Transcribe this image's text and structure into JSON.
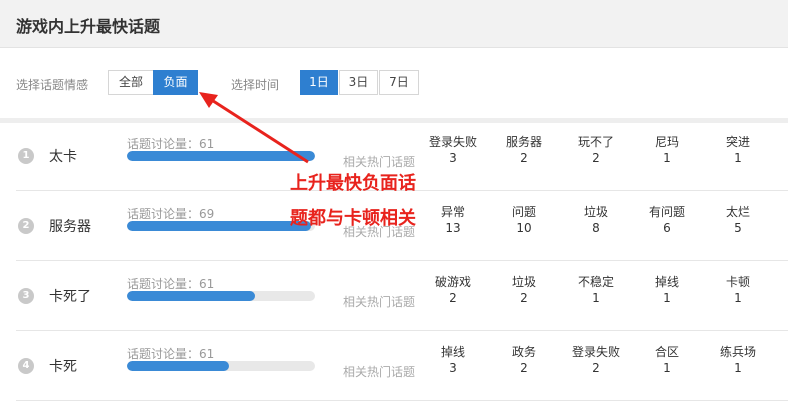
{
  "header": {
    "title": "游戏内上升最快话题"
  },
  "filters": {
    "emotion_label": "选择话题情感",
    "emotion_options": [
      "全部",
      "负面"
    ],
    "time_label": "选择时间",
    "time_options": [
      "1日",
      "3日",
      "7日"
    ]
  },
  "rows": [
    {
      "rank": "1",
      "topic": "太卡",
      "volume_label": "话题讨论量：61",
      "volume_fraction": 1.0,
      "related_label": "相关热门话题",
      "keywords": [
        {
          "w": "登录失败",
          "n": "3"
        },
        {
          "w": "服务器",
          "n": "2"
        },
        {
          "w": "玩不了",
          "n": "2"
        },
        {
          "w": "尼玛",
          "n": "1"
        },
        {
          "w": "突进",
          "n": "1"
        }
      ]
    },
    {
      "rank": "2",
      "topic": "服务器",
      "volume_label": "话题讨论量：69",
      "volume_fraction": 0.98,
      "related_label": "相关热门话题",
      "keywords": [
        {
          "w": "异常",
          "n": "13"
        },
        {
          "w": "问题",
          "n": "10"
        },
        {
          "w": "垃圾",
          "n": "8"
        },
        {
          "w": "有问题",
          "n": "6"
        },
        {
          "w": "太烂",
          "n": "5"
        }
      ]
    },
    {
      "rank": "3",
      "topic": "卡死了",
      "volume_label": "话题讨论量：61",
      "volume_fraction": 0.68,
      "related_label": "相关热门话题",
      "keywords": [
        {
          "w": "破游戏",
          "n": "2"
        },
        {
          "w": "垃圾",
          "n": "2"
        },
        {
          "w": "不稳定",
          "n": "1"
        },
        {
          "w": "掉线",
          "n": "1"
        },
        {
          "w": "卡顿",
          "n": "1"
        }
      ]
    },
    {
      "rank": "4",
      "topic": "卡死",
      "volume_label": "话题讨论量：61",
      "volume_fraction": 0.54,
      "related_label": "相关热门话题",
      "keywords": [
        {
          "w": "掉线",
          "n": "3"
        },
        {
          "w": "政务",
          "n": "2"
        },
        {
          "w": "登录失败",
          "n": "2"
        },
        {
          "w": "合区",
          "n": "1"
        },
        {
          "w": "练兵场",
          "n": "1"
        }
      ]
    }
  ],
  "annotation": {
    "line1": "上升最快负面话",
    "line2": "题都与卡顿相关",
    "color": "#e8231d"
  },
  "colors": {
    "accent": "#2e7fd0",
    "bar": "#3a8ad6"
  }
}
